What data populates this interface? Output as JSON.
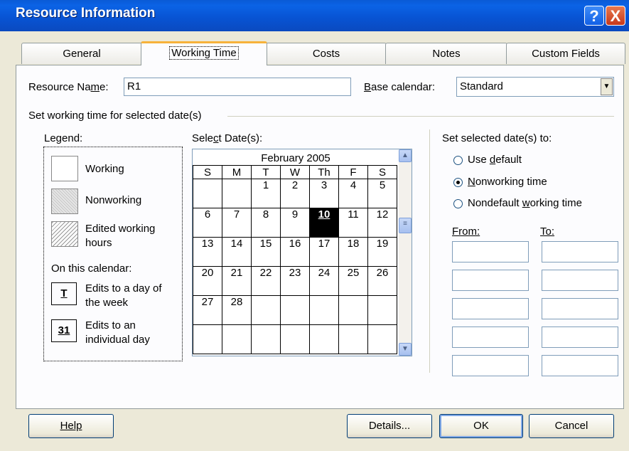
{
  "window": {
    "title": "Resource Information",
    "help_glyph": "?",
    "close_glyph": "X"
  },
  "tabs": [
    {
      "label": "General"
    },
    {
      "label": "Working Time"
    },
    {
      "label": "Costs"
    },
    {
      "label": "Notes"
    },
    {
      "label": "Custom Fields"
    }
  ],
  "resource": {
    "name_label_pre": "Resource Na",
    "name_label_ul": "m",
    "name_label_post": "e:",
    "name_value": "R1"
  },
  "base_calendar": {
    "label_ul": "B",
    "label_post": "ase calendar:",
    "value": "Standard"
  },
  "group_title": "Set working time for selected date(s)",
  "legend": {
    "title": "Legend:",
    "working": "Working",
    "nonworking": "Nonworking",
    "edited_1": "Edited working",
    "edited_2": "hours",
    "on_calendar": "On this calendar:",
    "t_glyph": "T",
    "edits_week_1": "Edits to a day of",
    "edits_week_2": "the week",
    "day_glyph": "31",
    "edits_day_1": "Edits to an",
    "edits_day_2": "individual day"
  },
  "select_dates": {
    "label_pre": "Sele",
    "label_ul": "c",
    "label_post": "t Date(s):"
  },
  "calendar": {
    "month": "February 2005",
    "weekdays": [
      "S",
      "M",
      "T",
      "W",
      "Th",
      "F",
      "S"
    ],
    "selected_day": "10",
    "weeks": [
      [
        "",
        "",
        "1",
        "2",
        "3",
        "4",
        "5"
      ],
      [
        "6",
        "7",
        "8",
        "9",
        "10",
        "11",
        "12"
      ],
      [
        "13",
        "14",
        "15",
        "16",
        "17",
        "18",
        "19"
      ],
      [
        "20",
        "21",
        "22",
        "23",
        "24",
        "25",
        "26"
      ],
      [
        "27",
        "28",
        "",
        "",
        "",
        "",
        ""
      ],
      [
        "",
        "",
        "",
        "",
        "",
        "",
        ""
      ]
    ]
  },
  "set_to": {
    "title": "Set selected date(s) to:",
    "use_default": {
      "pre": "Use ",
      "ul": "d",
      "post": "efault"
    },
    "nonworking": {
      "pre": "",
      "ul": "N",
      "post": "onworking time"
    },
    "nondefault": {
      "pre": "Nondefault ",
      "ul": "w",
      "post": "orking time"
    },
    "selected": "nonworking",
    "from_label": "From:",
    "to_label": "To:"
  },
  "buttons": {
    "help": "Help",
    "details": "Details...",
    "ok": "OK",
    "cancel": "Cancel"
  }
}
